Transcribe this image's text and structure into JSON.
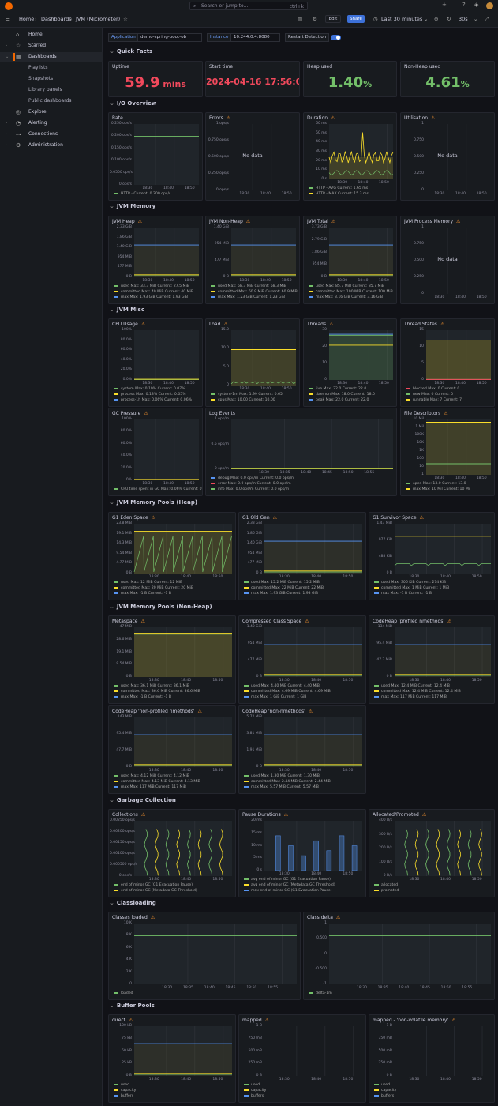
{
  "topbar": {
    "search_placeholder": "Search or jump to...",
    "search_shortcut": "ctrl+k",
    "plus": "+",
    "crumb_home": "Home",
    "crumb_dashboards": "Dashboards",
    "crumb_current": "JVM (Micrometer)",
    "edit_label": "Edit",
    "share_label": "Share",
    "time_range": "Last 30 minutes",
    "refresh_interval": "30s"
  },
  "sidebar": {
    "items": [
      {
        "label": "Home",
        "icon": "home-icon"
      },
      {
        "label": "Starred",
        "icon": "star-icon"
      },
      {
        "label": "Dashboards",
        "icon": "dashboards-icon"
      },
      {
        "label": "Playlists"
      },
      {
        "label": "Snapshots"
      },
      {
        "label": "Library panels"
      },
      {
        "label": "Public dashboards"
      },
      {
        "label": "Explore",
        "icon": "compass-icon"
      },
      {
        "label": "Alerting",
        "icon": "bell-icon"
      },
      {
        "label": "Connections",
        "icon": "connections-icon"
      },
      {
        "label": "Administration",
        "icon": "gear-icon"
      }
    ]
  },
  "variables": {
    "app_label": "Application",
    "app_value": "demo-spring-boot-ob",
    "instance_label": "Instance",
    "instance_value": "10.244.0.4:8080",
    "restart_label": "Restart Detection"
  },
  "rows": [
    "Quick Facts",
    "I/O Overview",
    "JVM Memory",
    "JVM Misc",
    "JVM Memory Pools (Heap)",
    "JVM Memory Pools (Non-Heap)",
    "Garbage Collection",
    "Classloading",
    "Buffer Pools"
  ],
  "stats": {
    "uptime": {
      "title": "Uptime",
      "value": "59.9",
      "unit": " mins",
      "color": "#f2495c"
    },
    "start": {
      "title": "Start time",
      "value": "2024-04-16 17:56:04",
      "color": "#f2495c"
    },
    "heap": {
      "title": "Heap used",
      "value": "1.40",
      "unit": "%",
      "color": "#73bf69"
    },
    "nonheap": {
      "title": "Non-Heap used",
      "value": "4.61",
      "unit": "%",
      "color": "#73bf69"
    }
  },
  "panels": {
    "rate": {
      "title": "Rate",
      "yticks": [
        "0.250 ops/s",
        "0.200 ops/s",
        "0.150 ops/s",
        "0.100 ops/s",
        "0.0500 ops/s",
        "0 ops/s"
      ],
      "xticks": [
        "18:30",
        "18:40",
        "18:50"
      ],
      "legend": [
        {
          "text": "HTTP - Current: 0.200 ops/s",
          "color": "#73bf69"
        }
      ]
    },
    "errors": {
      "title": "Errors",
      "yticks": [
        "1 ops/s",
        "0.750 ops/s",
        "0.500 ops/s",
        "0.250 ops/s",
        "0 ops/s"
      ],
      "xticks": [
        "18:30",
        "18:40",
        "18:50"
      ],
      "nodata": "No data"
    },
    "duration": {
      "title": "Duration",
      "yticks": [
        "60 ms",
        "50 ms",
        "40 ms",
        "30 ms",
        "20 ms",
        "10 ms",
        "0 s"
      ],
      "xticks": [
        "18:30",
        "18:40",
        "18:50"
      ],
      "legend": [
        {
          "text": "HTTP - AVG  Current: 1.65 ms",
          "color": "#73bf69"
        },
        {
          "text": "HTTP - MAX  Current: 15.3 ms",
          "color": "#fade2a"
        }
      ]
    },
    "util": {
      "title": "Utilisation",
      "yticks": [
        "1",
        "0.750",
        "0.500",
        "0.250",
        "0"
      ],
      "xticks": [
        "18:30",
        "18:40",
        "18:50"
      ],
      "nodata": "No data"
    },
    "jvmheap": {
      "title": "JVM Heap",
      "yticks": [
        "2.33 GiB",
        "1.86 GiB",
        "1.40 GiB",
        "954 MiB",
        "477 MiB",
        "0 B"
      ],
      "xticks": [
        "18:30",
        "18:40",
        "18:50"
      ],
      "legend": [
        {
          "text": "used   Max: 33.3 MiB  Current: 27.5 MiB",
          "color": "#73bf69"
        },
        {
          "text": "committed   Max: 40 MiB  Current: 40 MiB",
          "color": "#fade2a"
        },
        {
          "text": "max   Max: 1.93 GiB  Current: 1.93 GiB",
          "color": "#5794f2"
        }
      ]
    },
    "jvmnonheap": {
      "title": "JVM Non-Heap",
      "yticks": [
        "1.40 GiB",
        "954 MiB",
        "477 MiB",
        "0 B"
      ],
      "xticks": [
        "18:30",
        "18:40",
        "18:50"
      ],
      "legend": [
        {
          "text": "used   Max: 58.3 MiB  Current: 58.3 MiB",
          "color": "#73bf69"
        },
        {
          "text": "committed   Max: 60.9 MiB  Current: 60.9 MiB",
          "color": "#fade2a"
        },
        {
          "text": "max   Max: 1.23 GiB  Current: 1.23 GiB",
          "color": "#5794f2"
        }
      ]
    },
    "jvmtotal": {
      "title": "JVM Total",
      "yticks": [
        "3.73 GiB",
        "2.79 GiB",
        "1.86 GiB",
        "954 MiB",
        "0 B"
      ],
      "xticks": [
        "18:30",
        "18:40",
        "18:50"
      ],
      "legend": [
        {
          "text": "used   Max: 85.7 MiB  Current: 85.7 MiB",
          "color": "#73bf69"
        },
        {
          "text": "committed   Max: 100 MiB  Current: 100 MiB",
          "color": "#fade2a"
        },
        {
          "text": "max   Max: 3.16 GiB  Current: 3.16 GiB",
          "color": "#5794f2"
        }
      ]
    },
    "jvmproc": {
      "title": "JVM Process Memory",
      "yticks": [
        "1",
        "0.750",
        "0.500",
        "0.250",
        "0"
      ],
      "xticks": [
        "18:30",
        "18:40",
        "18:50"
      ],
      "nodata": "No data"
    },
    "cpu": {
      "title": "CPU Usage",
      "yticks": [
        "100%",
        "80.0%",
        "60.0%",
        "40.0%",
        "20.0%",
        "0.0%"
      ],
      "xticks": [
        "18:30",
        "18:40",
        "18:50"
      ],
      "legend": [
        {
          "text": "system   Max: 0.19%  Current: 0.07%",
          "color": "#73bf69"
        },
        {
          "text": "process   Max: 0.13%  Current: 0.05%",
          "color": "#fade2a"
        },
        {
          "text": "process-1h   Max: 0.06%  Current: 0.06%",
          "color": "#5794f2"
        }
      ]
    },
    "load": {
      "title": "Load",
      "yticks": [
        "15.0",
        "10.0",
        "5.0",
        "0"
      ],
      "xticks": [
        "18:30",
        "18:40",
        "18:50"
      ],
      "legend": [
        {
          "text": "system-1m   Max: 1.99  Current: 0.65",
          "color": "#73bf69"
        },
        {
          "text": "cpus   Max: 10.00  Current: 10.00",
          "color": "#fade2a"
        }
      ]
    },
    "threads": {
      "title": "Threads",
      "yticks": [
        "30",
        "20",
        "10",
        "0"
      ],
      "xticks": [
        "18:30",
        "18:40",
        "18:50"
      ],
      "legend": [
        {
          "text": "live   Max: 22.0  Current: 22.0",
          "color": "#73bf69"
        },
        {
          "text": "daemon   Max: 18.0  Current: 18.0",
          "color": "#fade2a"
        },
        {
          "text": "peak   Max: 22.0  Current: 22.0",
          "color": "#5794f2"
        }
      ]
    },
    "tstates": {
      "title": "Thread States",
      "yticks": [
        "15",
        "10",
        "5",
        "0"
      ],
      "xticks": [
        "18:30",
        "18:40",
        "18:50"
      ],
      "legend": [
        {
          "text": "blocked   Max: 0  Current: 0",
          "color": "#f2495c"
        },
        {
          "text": "new   Max: 0  Current: 0",
          "color": "#73bf69"
        },
        {
          "text": "runnable   Max: 7  Current: 7",
          "color": "#fade2a"
        }
      ]
    },
    "gcp": {
      "title": "GC Pressure",
      "yticks": [
        "100%",
        "80.0%",
        "60.0%",
        "40.0%",
        "20.0%",
        "0%"
      ],
      "xticks": [
        "18:30",
        "18:40",
        "18:50"
      ],
      "legend": [
        {
          "text": "CPU time spent in GC   Max: 0.06%  Current: 0%",
          "color": "#73bf69"
        }
      ]
    },
    "logev": {
      "title": "Log Events",
      "yticks": [
        "1 ops/m",
        "0.5 ops/m",
        "0 ops/m"
      ],
      "xticks": [
        "18:30",
        "18:35",
        "18:40",
        "18:45",
        "18:50",
        "18:55"
      ],
      "legend": [
        {
          "text": "debug   Max: 0.0 ops/m  Current: 0.0 ops/m",
          "color": "#5794f2"
        },
        {
          "text": "error   Max: 0.0 ops/m  Current: 0.0 ops/m",
          "color": "#f2495c"
        },
        {
          "text": "info   Max: 0.0 ops/m  Current: 0.0 ops/m",
          "color": "#73bf69"
        }
      ]
    },
    "fdesc": {
      "title": "File Descriptors",
      "yticks": [
        "10 Mil",
        "1 Mil",
        "100K",
        "10K",
        "1K",
        "100",
        "10",
        "1"
      ],
      "xticks": [
        "18:30",
        "18:40",
        "18:50"
      ],
      "legend": [
        {
          "text": "open   Max: 13.0  Current: 13.0",
          "color": "#73bf69"
        },
        {
          "text": "max   Max: 10 Mil  Current: 10 Mil",
          "color": "#fade2a"
        }
      ]
    },
    "eden": {
      "title": "G1 Eden Space",
      "yticks": [
        "23.8 MiB",
        "19.1 MiB",
        "14.3 MiB",
        "9.54 MiB",
        "4.77 MiB",
        "0 B"
      ],
      "xticks": [
        "18:30",
        "18:40",
        "18:50"
      ],
      "legend": [
        {
          "text": "used   Max: 12 MiB  Current: 12 MiB",
          "color": "#73bf69"
        },
        {
          "text": "committed   Max: 20 MiB  Current: 20 MiB",
          "color": "#fade2a"
        },
        {
          "text": "max   Max: -1 B  Current: -1 B",
          "color": "#5794f2"
        }
      ]
    },
    "oldgen": {
      "title": "G1 Old Gen",
      "yticks": [
        "2.33 GiB",
        "1.86 GiB",
        "1.40 GiB",
        "954 MiB",
        "477 MiB",
        "0 B"
      ],
      "xticks": [
        "18:30",
        "18:40",
        "18:50"
      ],
      "legend": [
        {
          "text": "used   Max: 15.2 MiB  Current: 15.2 MiB",
          "color": "#73bf69"
        },
        {
          "text": "committed   Max: 22 MiB  Current: 22 MiB",
          "color": "#fade2a"
        },
        {
          "text": "max   Max: 1.93 GiB  Current: 1.93 GiB",
          "color": "#5794f2"
        }
      ]
    },
    "survivor": {
      "title": "G1 Survivor Space",
      "yticks": [
        "1.43 MiB",
        "977 KiB",
        "488 KiB",
        "0 B"
      ],
      "xticks": [
        "18:30",
        "18:40",
        "18:50"
      ],
      "legend": [
        {
          "text": "used   Max: 306 KiB  Current: 274 KiB",
          "color": "#73bf69"
        },
        {
          "text": "committed   Max: 1 MiB  Current: 1 MiB",
          "color": "#fade2a"
        },
        {
          "text": "max   Max: -1 B  Current: -1 B",
          "color": "#5794f2"
        }
      ]
    },
    "meta": {
      "title": "Metaspace",
      "yticks": [
        "47 MiB",
        "28.6 MiB",
        "19.1 MiB",
        "9.54 MiB",
        "0 B"
      ],
      "xticks": [
        "18:30",
        "18:40",
        "18:50"
      ],
      "legend": [
        {
          "text": "used   Max: 36.1 MiB  Current: 36.1 MiB",
          "color": "#73bf69"
        },
        {
          "text": "committed   Max: 36.6 MiB  Current: 36.6 MiB",
          "color": "#fade2a"
        },
        {
          "text": "max   Max: -1 B  Current: -1 B",
          "color": "#5794f2"
        }
      ]
    },
    "ccs": {
      "title": "Compressed Class Space",
      "yticks": [
        "1.40 GiB",
        "954 MiB",
        "477 MiB",
        "0 B"
      ],
      "xticks": [
        "18:30",
        "18:40",
        "18:50"
      ],
      "legend": [
        {
          "text": "used   Max: 4.40 MiB  Current: 4.40 MiB",
          "color": "#73bf69"
        },
        {
          "text": "committed   Max: 4.69 MiB  Current: 4.69 MiB",
          "color": "#fade2a"
        },
        {
          "text": "max   Max: 1 GiB  Current: 1 GiB",
          "color": "#5794f2"
        }
      ]
    },
    "chprof": {
      "title": "CodeHeap 'profiled nmethods'",
      "yticks": [
        "134 MiB",
        "95.4 MiB",
        "47.7 MiB",
        "0 B"
      ],
      "xticks": [
        "18:30",
        "18:40",
        "18:50"
      ],
      "legend": [
        {
          "text": "used   Max: 12.4 MiB  Current: 12.4 MiB",
          "color": "#73bf69"
        },
        {
          "text": "committed   Max: 12.4 MiB  Current: 12.4 MiB",
          "color": "#fade2a"
        },
        {
          "text": "max   Max: 117 MiB  Current: 117 MiB",
          "color": "#5794f2"
        }
      ]
    },
    "chnonprof": {
      "title": "CodeHeap 'non-profiled nmethods'",
      "yticks": [
        "143 MiB",
        "95.4 MiB",
        "47.7 MiB",
        "0 B"
      ],
      "xticks": [
        "18:30",
        "18:40",
        "18:50"
      ],
      "legend": [
        {
          "text": "used   Max: 4.12 MiB  Current: 4.12 MiB",
          "color": "#73bf69"
        },
        {
          "text": "committed   Max: 4.13 MiB  Current: 4.13 MiB",
          "color": "#fade2a"
        },
        {
          "text": "max   Max: 117 MiB  Current: 117 MiB",
          "color": "#5794f2"
        }
      ]
    },
    "chnon": {
      "title": "CodeHeap 'non-nmethods'",
      "yticks": [
        "5.72 MiB",
        "3.81 MiB",
        "1.91 MiB",
        "0 B"
      ],
      "xticks": [
        "18:30",
        "18:40",
        "18:50"
      ],
      "legend": [
        {
          "text": "used   Max: 1.30 MiB  Current: 1.30 MiB",
          "color": "#73bf69"
        },
        {
          "text": "committed   Max: 2.44 MiB  Current: 2.44 MiB",
          "color": "#fade2a"
        },
        {
          "text": "max   Max: 5.57 MiB  Current: 5.57 MiB",
          "color": "#5794f2"
        }
      ]
    },
    "gccoll": {
      "title": "Collections",
      "yticks": [
        "0.00250 ops/s",
        "0.00200 ops/s",
        "0.00150 ops/s",
        "0.00100 ops/s",
        "0.000500 ops/s",
        "0 ops/s"
      ],
      "xticks": [
        "18:30",
        "18:40",
        "18:50"
      ],
      "legend": [
        {
          "text": "end of minor GC (G1 Evacuation Pause)",
          "color": "#73bf69"
        },
        {
          "text": "end of minor GC (Metadata GC Threshold)",
          "color": "#fade2a"
        }
      ]
    },
    "gcpause": {
      "title": "Pause Durations",
      "yticks": [
        "20 ms",
        "15 ms",
        "10 ms",
        "5 ms",
        "0 s"
      ],
      "xticks": [
        "18:30",
        "18:40",
        "18:50"
      ],
      "legend": [
        {
          "text": "avg end of minor GC (G1 Evacuation Pause)",
          "color": "#73bf69"
        },
        {
          "text": "avg end of minor GC (Metadata GC Threshold)",
          "color": "#fade2a"
        },
        {
          "text": "max end of minor GC (G1 Evacuation Pause)",
          "color": "#5794f2"
        }
      ]
    },
    "alloc": {
      "title": "Allocated/Promoted",
      "yticks": [
        "400 B/s",
        "300 B/s",
        "200 B/s",
        "100 B/s",
        "0 B/s"
      ],
      "xticks": [
        "18:30",
        "18:40",
        "18:50"
      ],
      "legend": [
        {
          "text": "allocated",
          "color": "#73bf69"
        },
        {
          "text": "promoted",
          "color": "#fade2a"
        }
      ]
    },
    "classes": {
      "title": "Classes loaded",
      "yticks": [
        "10 K",
        "8 K",
        "6 K",
        "4 K",
        "2 K",
        "0"
      ],
      "xticks": [
        "18:30",
        "18:35",
        "18:40",
        "18:45",
        "18:50",
        "18:55"
      ],
      "legend": [
        {
          "text": "loaded",
          "color": "#73bf69"
        }
      ]
    },
    "classdelta": {
      "title": "Class delta",
      "yticks": [
        "1",
        "0.500",
        "0",
        "-0.500",
        "-1"
      ],
      "xticks": [
        "18:30",
        "18:35",
        "18:40",
        "18:45",
        "18:50",
        "18:55"
      ],
      "legend": [
        {
          "text": "delta-1m",
          "color": "#73bf69"
        }
      ]
    },
    "direct": {
      "title": "direct",
      "yticks": [
        "100 kB",
        "75 kB",
        "50 kB",
        "25 kB",
        "0 B"
      ],
      "xticks": [
        "18:30",
        "18:40",
        "18:50"
      ],
      "legend": [
        {
          "text": "used",
          "color": "#73bf69"
        },
        {
          "text": "capacity",
          "color": "#fade2a"
        },
        {
          "text": "buffers",
          "color": "#5794f2"
        }
      ]
    },
    "mapped": {
      "title": "mapped",
      "yticks": [
        "1 B",
        "750 mB",
        "500 mB",
        "250 mB",
        "0 B"
      ],
      "xticks": [
        "18:30",
        "18:40",
        "18:50"
      ],
      "legend": [
        {
          "text": "used",
          "color": "#73bf69"
        },
        {
          "text": "capacity",
          "color": "#fade2a"
        },
        {
          "text": "buffers",
          "color": "#5794f2"
        }
      ]
    },
    "mappednv": {
      "title": "mapped - 'non-volatile memory'",
      "yticks": [
        "1 B",
        "750 mB",
        "500 mB",
        "250 mB",
        "0 B"
      ],
      "xticks": [
        "18:30",
        "18:40",
        "18:50"
      ],
      "legend": [
        {
          "text": "used",
          "color": "#73bf69"
        },
        {
          "text": "capacity",
          "color": "#fade2a"
        },
        {
          "text": "buffers",
          "color": "#5794f2"
        }
      ]
    }
  }
}
